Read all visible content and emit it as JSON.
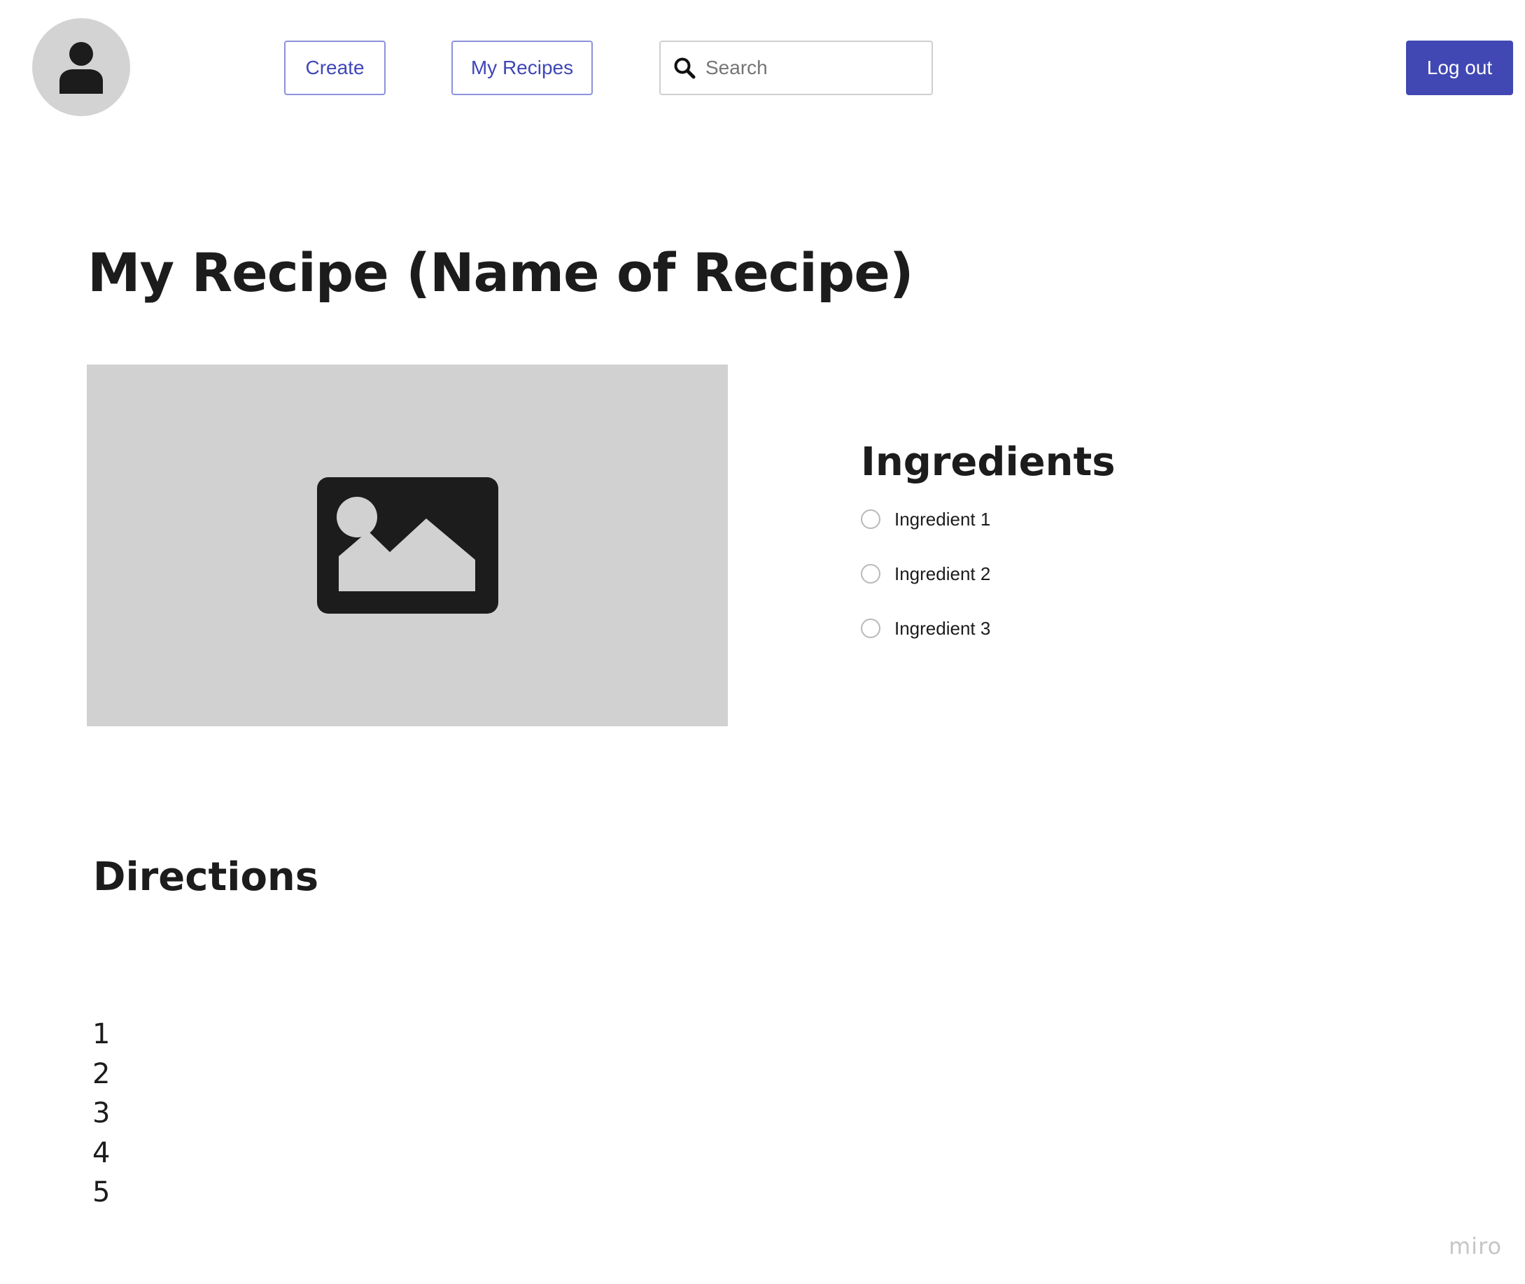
{
  "header": {
    "avatar_icon": "user-icon",
    "create_label": "Create",
    "my_recipes_label": "My Recipes",
    "search": {
      "value": "",
      "placeholder": "Search",
      "icon": "search-icon"
    },
    "logout_label": "Log out",
    "accent_color": "#4148b3"
  },
  "recipe": {
    "title": "My Recipe (Name of Recipe)",
    "image_icon": "image-icon",
    "ingredients_heading": "Ingredients",
    "ingredients": [
      {
        "label": "Ingredient 1"
      },
      {
        "label": "Ingredient 2"
      },
      {
        "label": "Ingredient 3"
      }
    ],
    "directions_heading": "Directions",
    "directions": [
      "1",
      "2",
      "3",
      "4",
      "5"
    ]
  },
  "watermark": "miro"
}
